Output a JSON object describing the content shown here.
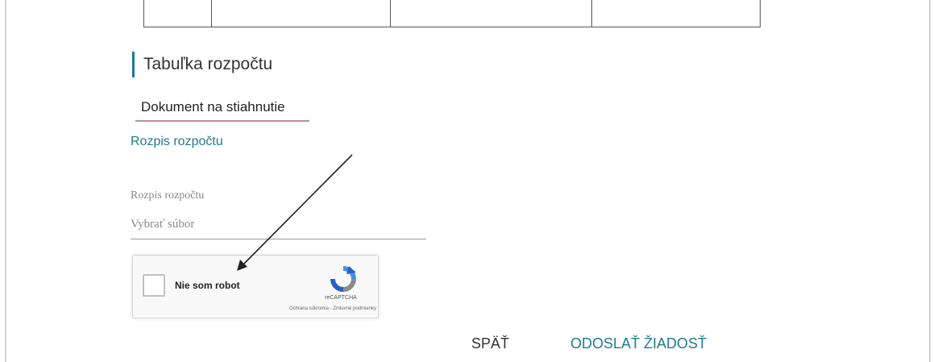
{
  "budget_section": {
    "title": "Tabuľka rozpočtu",
    "download_tab": "Dokument na stiahnutie",
    "budget_link": "Rozpis rozpočtu"
  },
  "file_upload": {
    "label": "Rozpis rozpočtu",
    "placeholder": "Vybrať súbor"
  },
  "recaptcha": {
    "checkbox_label": "Nie som robot",
    "brand": "reCAPTCHA",
    "terms": "Ochrana súkromia - Zmluvné podmienky",
    "logo_icon": "recaptcha-logo-icon"
  },
  "actions": {
    "back_label": "SPÄŤ",
    "submit_label": "ODOSLAŤ ŽIADOSŤ"
  },
  "colors": {
    "accent": "#1f7a8f",
    "tab_underline": "#c48a9d"
  }
}
